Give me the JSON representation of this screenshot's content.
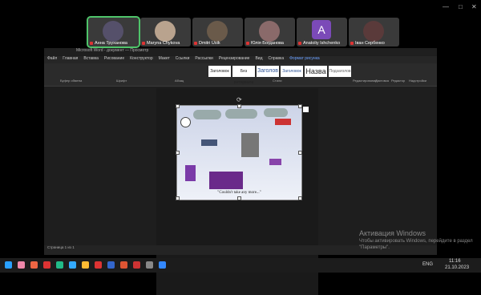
{
  "participants": [
    {
      "name": "Анна Труханова",
      "active": true
    },
    {
      "name": "Maryna Chykova",
      "active": false
    },
    {
      "name": "Dmitri Usik",
      "active": false
    },
    {
      "name": "Юлія Богданова",
      "active": false
    },
    {
      "name": "Anatoliy Ishchenko",
      "initial": "A",
      "active": false
    },
    {
      "name": "Іван Сербенко",
      "active": false
    }
  ],
  "word": {
    "title": "Microsoft Word - документ — Просмотр",
    "tabs": [
      "Файл",
      "Главная",
      "Вставка",
      "Рисование",
      "Конструктор",
      "Макет",
      "Ссылки",
      "Рассылки",
      "Рецензирование",
      "Вид",
      "Справка",
      "Формат рисунка"
    ],
    "styles": [
      "Заголовок",
      "Без интервала",
      "Заголов",
      "Заголовок",
      "Назва",
      "Подзаголов"
    ],
    "groups": [
      "Буфер обмена",
      "Шрифт",
      "Абзац",
      "Стили",
      "Редактирование",
      "Диктовка",
      "Редактор",
      "Надстройки"
    ],
    "status": "Страница 1 из 1",
    "caption": "\"Couldn't take any more...\""
  },
  "watermark": {
    "title": "Активация Windows",
    "line1": "Чтобы активировать Windows, перейдите в раздел",
    "line2": "\"Параметры\"."
  },
  "taskbar": {
    "lang": "ENG",
    "time": "11:16",
    "date": "21.10.2023"
  }
}
